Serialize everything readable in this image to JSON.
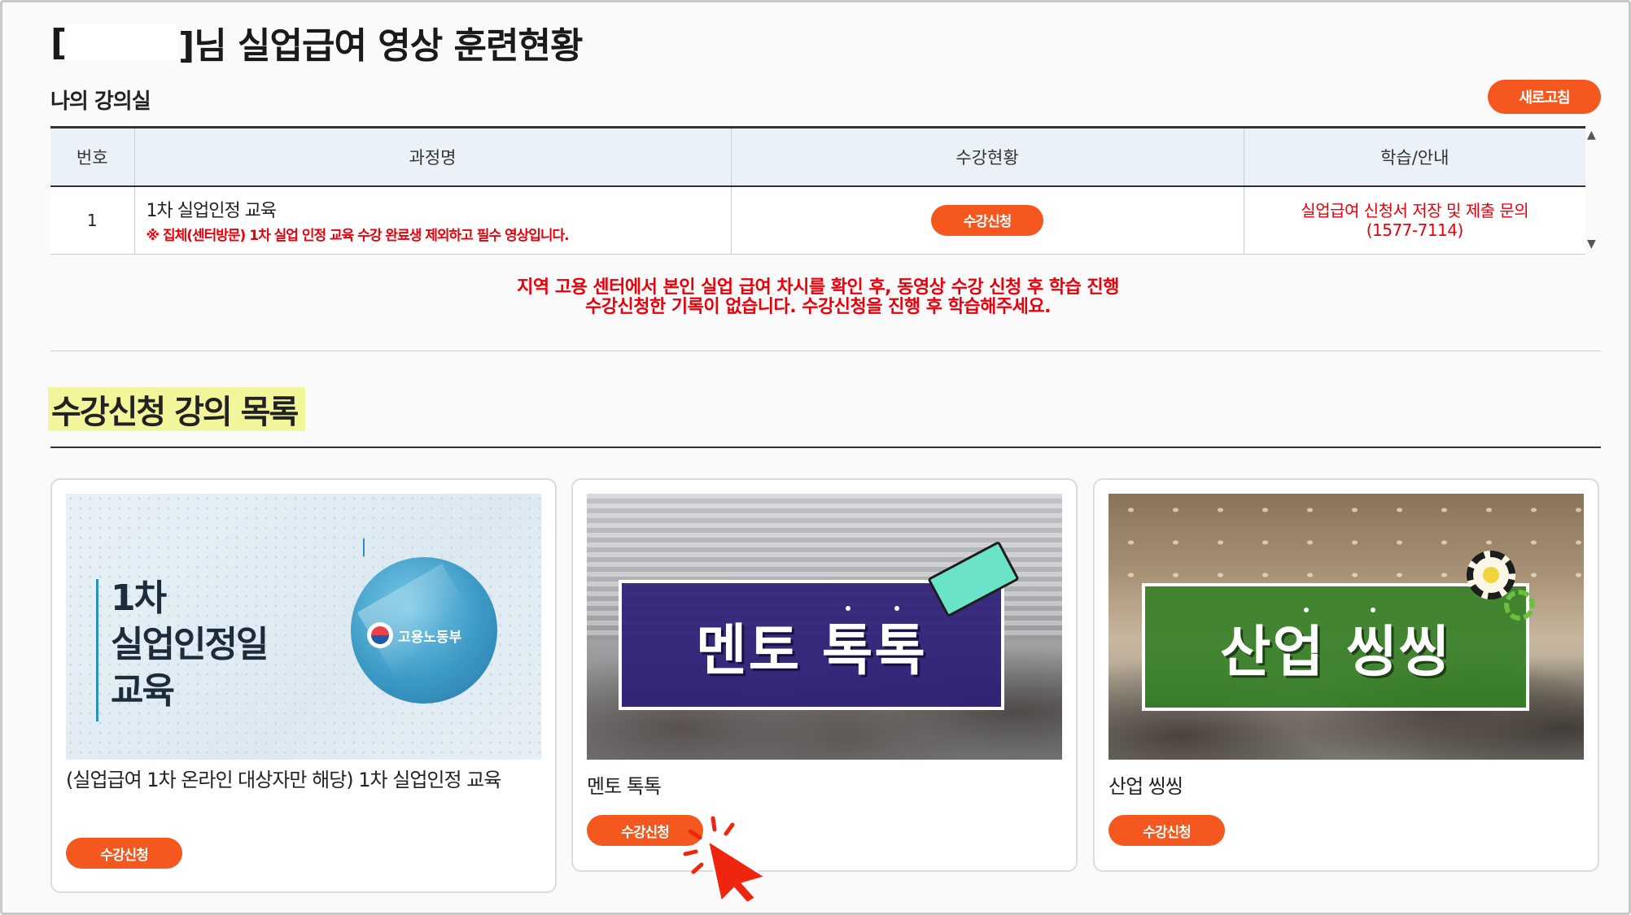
{
  "header": {
    "title_open_bracket": "[",
    "title_suffix": "]님 실업급여 영상 훈련현황"
  },
  "my_classroom": {
    "label": "나의 강의실",
    "refresh_label": "새로고침",
    "table": {
      "columns": [
        "번호",
        "과정명",
        "수강현황",
        "학습/안내"
      ],
      "rows": [
        {
          "number": "1",
          "course_name": "1차 실업인정 교육",
          "course_note": "※ 집체(센터방문) 1차 실업 인정 교육 수강 완료생 제외하고 필수 영상입니다.",
          "status_button": "수강신청",
          "guide_line1": "실업급여 신청서 저장 및 제출 문의",
          "guide_line2": "(1577-7114)"
        }
      ]
    },
    "notice_line1": "지역 고용 센터에서 본인 실업 급여 차시를 확인 후, 동영상 수강 신청 후 학습 진행",
    "notice_line2": "수강신청한 기록이 없습니다. 수강신청을 진행 후 학습해주세요."
  },
  "course_list": {
    "title": "수강신청 강의 목록",
    "cards": [
      {
        "thumb_text_line1": "1차",
        "thumb_text_line2": "실업인정일",
        "thumb_text_line3": "교육",
        "thumb_logo_text": "고용노동부",
        "title": "(실업급여 1차 온라인 대상자만 해당) 1차 실업인정 교육",
        "button": "수강신청"
      },
      {
        "banner_text": "멘토 톡톡",
        "title": "멘토 톡톡",
        "button": "수강신청"
      },
      {
        "banner_text": "산업 씽씽",
        "title": "산업 씽씽",
        "button": "수강신청"
      }
    ]
  },
  "colors": {
    "accent": "#f4581f",
    "alert_red": "#e8000b",
    "highlight": "#f3f59a",
    "mentor_banner": "#2e2078",
    "industry_banner": "#348026"
  },
  "icons": {
    "cursor": "click-hand-cursor-icon",
    "book": "book-icon",
    "gear": "gear-icon"
  }
}
